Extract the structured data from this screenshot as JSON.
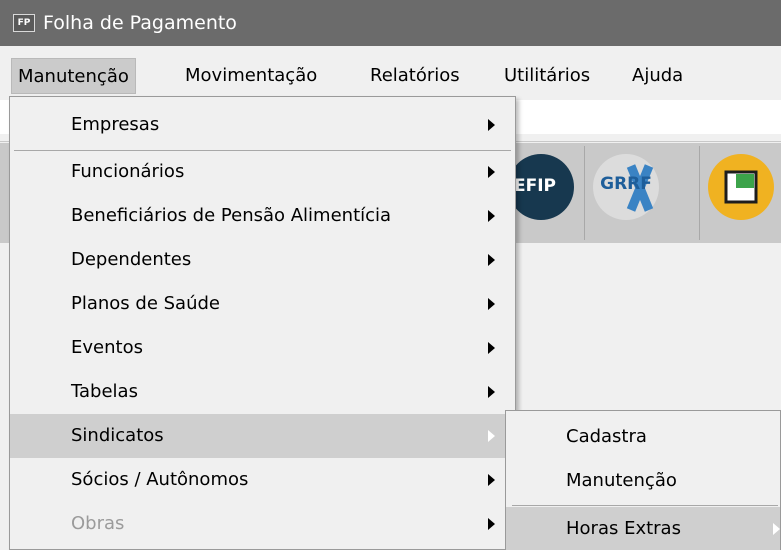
{
  "window": {
    "icon_text": "FP",
    "title": "Folha de Pagamento"
  },
  "menubar": [
    {
      "label": "Manutenção"
    },
    {
      "label": "Movimentação"
    },
    {
      "label": "Relatórios"
    },
    {
      "label": "Utilitários"
    },
    {
      "label": "Ajuda"
    }
  ],
  "toolbar": {
    "buttons": [
      {
        "label": "EFIP",
        "icon": "sefip-icon"
      },
      {
        "label": "GRRF",
        "icon": "grrf-icon"
      },
      {
        "label": "",
        "icon": "folder-icon"
      }
    ]
  },
  "menu": {
    "items": [
      {
        "label": "Empresas",
        "has_submenu": true
      },
      {
        "label": "Funcionários",
        "has_submenu": true
      },
      {
        "label": "Beneficiários de Pensão Alimentícia",
        "has_submenu": true
      },
      {
        "label": "Dependentes",
        "has_submenu": true
      },
      {
        "label": "Planos de Saúde",
        "has_submenu": true
      },
      {
        "label": "Eventos",
        "has_submenu": true
      },
      {
        "label": "Tabelas",
        "has_submenu": true
      },
      {
        "label": "Sindicatos",
        "has_submenu": true,
        "highlighted": true
      },
      {
        "label": "Sócios / Autônomos",
        "has_submenu": true
      },
      {
        "label": "Obras",
        "has_submenu": true,
        "disabled": true
      }
    ]
  },
  "submenu": {
    "items": [
      {
        "label": "Cadastra"
      },
      {
        "label": "Manutenção"
      },
      {
        "label": "Horas Extras",
        "has_submenu": true,
        "highlighted": true
      }
    ]
  },
  "colors": {
    "titlebar": "#6b6b6b",
    "highlight": "#cfcfcf",
    "toolbar": "#c9c9c9",
    "sefip_icon": "#17384f",
    "grrf_icon": "#dcdcdc",
    "folder_icon": "#f0b221"
  }
}
